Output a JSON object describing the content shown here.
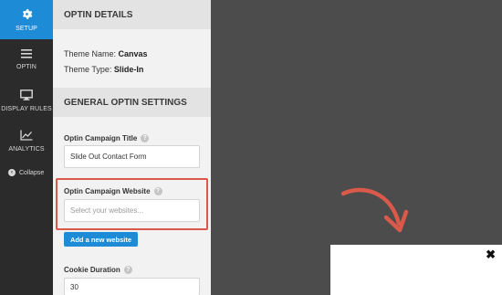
{
  "nav": {
    "items": [
      {
        "label": "SETUP",
        "icon": "gear-icon",
        "active": true
      },
      {
        "label": "OPTIN",
        "icon": "menu-icon",
        "active": false
      },
      {
        "label": "DISPLAY RULES",
        "icon": "monitor-icon",
        "active": false
      },
      {
        "label": "ANALYTICS",
        "icon": "chart-icon",
        "active": false
      }
    ],
    "collapse_label": "Collapse"
  },
  "panel": {
    "optin_details_title": "OPTIN DETAILS",
    "theme_name_label": "Theme Name:",
    "theme_name_value": "Canvas",
    "theme_type_label": "Theme Type:",
    "theme_type_value": "Slide-In",
    "general_settings_title": "GENERAL OPTIN SETTINGS",
    "fields": {
      "campaign_title_label": "Optin Campaign Title",
      "campaign_title_value": "Slide Out Contact Form",
      "campaign_website_label": "Optin Campaign Website",
      "campaign_website_placeholder": "Select your websites...",
      "add_website_button": "Add a new website",
      "cookie_duration_label": "Cookie Duration",
      "cookie_duration_value": "30"
    },
    "help_glyph": "?"
  },
  "preview": {
    "close_glyph": "✖"
  },
  "colors": {
    "accent": "#1e8bd6",
    "highlight": "#d9594a",
    "sidebar": "#2b2b2b",
    "preview_bg": "#4c4c4c"
  }
}
